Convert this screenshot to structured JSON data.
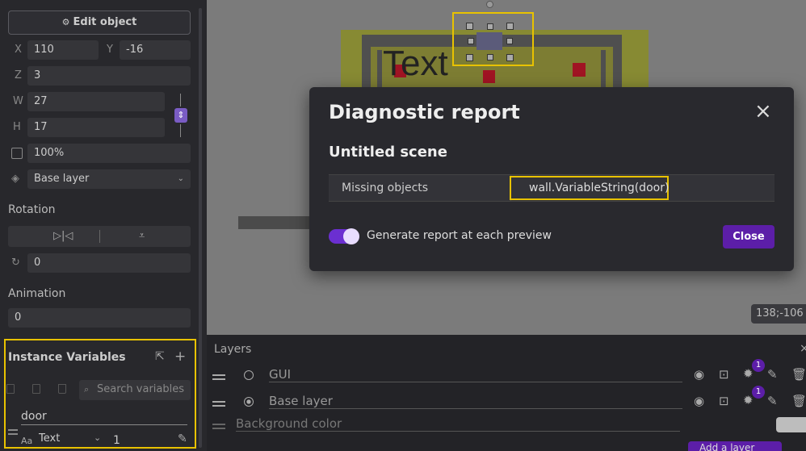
{
  "properties": {
    "edit_object_label": "Edit object",
    "x_label": "X",
    "x_value": "110",
    "y_label": "Y",
    "y_value": "-16",
    "z_label": "Z",
    "z_value": "3",
    "w_label": "W",
    "w_value": "27",
    "h_label": "H",
    "h_value": "17",
    "opacity_value": "100%",
    "layer_value": "Base layer",
    "rotation_title": "Rotation",
    "angle_value": "0",
    "animation_title": "Animation",
    "animation_value": "0"
  },
  "instance_variables": {
    "title": "Instance Variables",
    "search_placeholder": "Search variables",
    "var_name": "door",
    "var_type": "Text",
    "var_value": "1"
  },
  "scene": {
    "canvas_text": "Text",
    "coords": "138;-106"
  },
  "dialog": {
    "title": "Diagnostic report",
    "scene_name": "Untitled scene",
    "row_label": "Missing objects",
    "row_value": "wall.VariableString(door)",
    "toggle_label": "Generate report at each preview",
    "close_label": "Close"
  },
  "layers": {
    "title": "Layers",
    "items": [
      {
        "name": "GUI",
        "badge": "1"
      },
      {
        "name": "Base layer",
        "badge": "1"
      }
    ],
    "background_label": "Background color",
    "add_layer_label": "Add a layer"
  },
  "colors": {
    "accent": "#5c1ea8",
    "highlight": "#e8c200",
    "toggle_track": "#6b2fd1"
  }
}
